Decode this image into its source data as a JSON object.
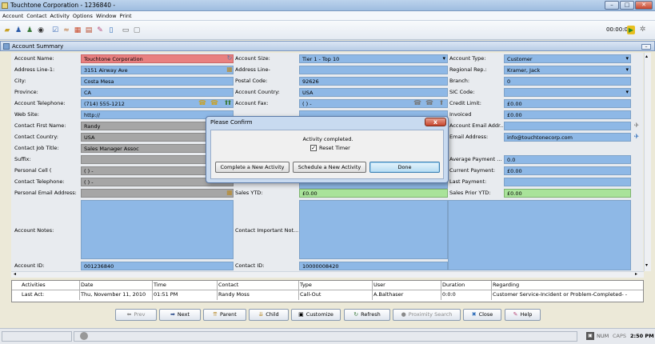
{
  "window": {
    "title": "Touchtone Corporation - 1236840 -"
  },
  "menu": [
    "Account",
    "Contact",
    "Activity",
    "Options",
    "Window",
    "Print"
  ],
  "toolbar": {
    "timer": "00:00:00"
  },
  "panel": {
    "title": "Account Summary"
  },
  "left": {
    "rows": [
      {
        "label": "Account Name:",
        "value": "Touchtone Corporation",
        "style": "red"
      },
      {
        "label": "Address Line-1:",
        "value": "3151 Airway Ave",
        "style": "blue"
      },
      {
        "label": "City:",
        "value": "Costa Mesa",
        "style": "blue"
      },
      {
        "label": "Province:",
        "value": "CA",
        "style": "blue"
      },
      {
        "label": "Account Telephone:",
        "value": "(714) 555-1212",
        "style": "blue"
      },
      {
        "label": "Web Site:",
        "value": "http://",
        "style": "blue"
      },
      {
        "label": "Contact First Name:",
        "value": "Randy",
        "style": "gray"
      },
      {
        "label": "Contact Country:",
        "value": "USA",
        "style": "gray"
      },
      {
        "label": "Contact Job Title:",
        "value": "Sales Manager Assoc",
        "style": "gray"
      },
      {
        "label": "Suffix:",
        "value": "",
        "style": "gray"
      },
      {
        "label": "Personal Cell (",
        "value": "( )  -",
        "style": "gray"
      },
      {
        "label": "Contact Telephone:",
        "value": "( )  -",
        "style": "gray"
      },
      {
        "label": "Personal Email Address:",
        "value": "",
        "style": "gray"
      }
    ],
    "notes_label": "Account Notes:",
    "id_label": "Account ID:",
    "id_value": "001236840"
  },
  "middle": {
    "rows": [
      {
        "label": "Account Size:",
        "value": "Tier 1 - Top 10",
        "dd": true
      },
      {
        "label": "Address Line-",
        "value": ""
      },
      {
        "label": "Postal Code:",
        "value": "92626"
      },
      {
        "label": "Account Country:",
        "value": "USA"
      },
      {
        "label": "Account Fax:",
        "value": "( )  -"
      }
    ],
    "sales_ytd_label": "Sales YTD:",
    "sales_ytd_value": "£0.00",
    "important_label": "Contact Important Not...",
    "contact_id_label": "Contact ID:",
    "contact_id_value": "10000008420"
  },
  "right": {
    "rows": [
      {
        "label": "Account Type:",
        "value": "Customer",
        "dd": true,
        "style": "blue"
      },
      {
        "label": "Regional Rep.:",
        "value": "Kramer, Jack",
        "dd": true,
        "style": "blue"
      },
      {
        "label": "Branch:",
        "value": "0",
        "style": "blue"
      },
      {
        "label": "SIC Code:",
        "value": "",
        "dd": true,
        "style": "blue"
      },
      {
        "label": "Credit Limit:",
        "value": "£0.00",
        "style": "blue"
      },
      {
        "label": "Invoiced",
        "value": "£0.00",
        "style": "blue"
      },
      {
        "label": "Account Email Addr...",
        "value": "",
        "style": "blue"
      },
      {
        "label": "Email Address:",
        "value": "info@touchtonecorp.com",
        "style": "blue"
      },
      {
        "label": "",
        "value": "",
        "style": "none"
      },
      {
        "label": "Average Payment ...",
        "value": "0.0",
        "style": "blue"
      },
      {
        "label": "Current Payment:",
        "value": "£0.00",
        "style": "blue"
      },
      {
        "label": "Last Payment:",
        "value": "",
        "style": "blue"
      },
      {
        "label": "Sales Prior YTD:",
        "value": "£0.00",
        "style": "green"
      }
    ]
  },
  "grid": {
    "headers": [
      "Activities",
      "Date",
      "Time",
      "Contact",
      "Type",
      "User",
      "Duration",
      "Regarding"
    ],
    "row": [
      "Last Act:",
      "Thu, November 11, 2010",
      "01:51 PM",
      "Randy Moss",
      "Call-Out",
      "A.Balthaser",
      "0:0:0",
      "Customer Service-Incident or Problem-Completed- -"
    ]
  },
  "buttons": [
    "Prev",
    "Next",
    "Parent",
    "Child",
    "Customize",
    "Refresh",
    "Proximity Search",
    "Close",
    "Help"
  ],
  "status": {
    "num": "NUM",
    "caps": "CAPS",
    "time": "2:50 PM"
  },
  "dialog": {
    "title": "Please Confirm",
    "message": "Activity completed.",
    "checkbox_label": "Reset Timer",
    "btn_new_activity": "Complete a New Activity",
    "btn_schedule": "Schedule a New Activity",
    "btn_done": "Done"
  }
}
